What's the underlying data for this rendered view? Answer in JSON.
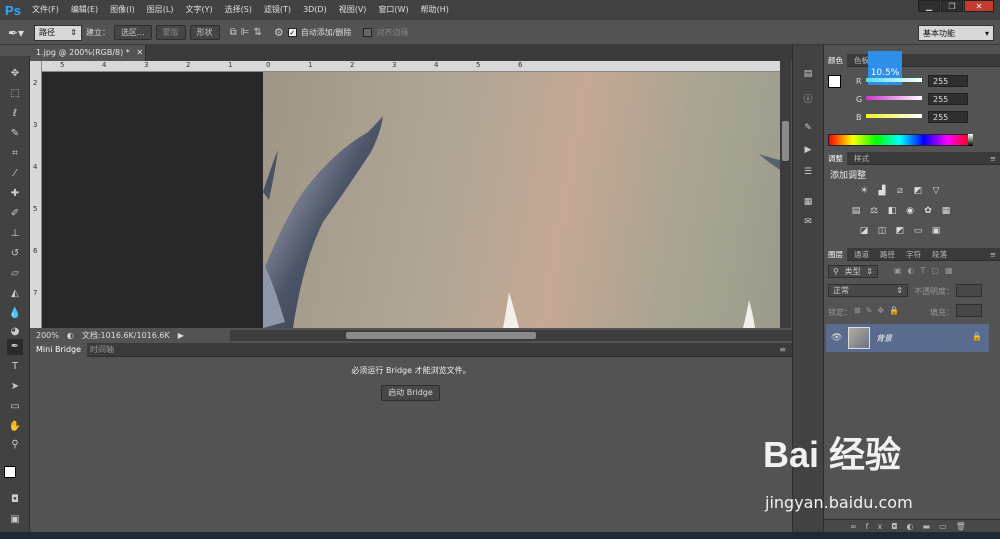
{
  "app": {
    "logo": "Ps"
  },
  "menu": [
    "文件(F)",
    "编辑(E)",
    "图像(I)",
    "图层(L)",
    "文字(Y)",
    "选择(S)",
    "滤镜(T)",
    "3D(D)",
    "视图(V)",
    "窗口(W)",
    "帮助(H)"
  ],
  "window_controls": {
    "minimize": "▁",
    "restore": "❐",
    "close": "✕"
  },
  "options": {
    "tool_mode": "路径",
    "build_label": "建立：",
    "selection_btn": "选区...",
    "mask_btn": "蒙版",
    "shape_btn": "形状",
    "auto_add_delete": "自动添加/删除",
    "align_edges": "对齐边缘",
    "workspace": "基本功能"
  },
  "document": {
    "tab_title": "1.jpg @ 200%(RGB/8) *",
    "zoom": "200%",
    "doc_info": "文档:1016.6K/1016.6K",
    "ruler_top_labels": [
      "5",
      "4",
      "3",
      "2",
      "1",
      "0",
      "1",
      "2",
      "3",
      "4",
      "5",
      "6"
    ],
    "ruler_left_labels": [
      "2",
      "3",
      "4",
      "5",
      "6",
      "7"
    ]
  },
  "bridge": {
    "tab_mini_bridge": "Mini Bridge",
    "tab_timeline": "时间轴",
    "message": "必须运行 Bridge 才能浏览文件。",
    "launch_button": "启动 Bridge"
  },
  "color_panel": {
    "tab_color": "颜色",
    "tab_swatches": "色板",
    "tooltip": "10.5%",
    "channels": [
      {
        "label": "R",
        "value": "255",
        "color": "#e8e8e8"
      },
      {
        "label": "G",
        "value": "255",
        "color": "#e040e0"
      },
      {
        "label": "B",
        "value": "255",
        "color": "#f0f040"
      }
    ]
  },
  "adjust_panel": {
    "tab_adjust": "调整",
    "tab_styles": "样式",
    "heading": "添加调整"
  },
  "layers_panel": {
    "tabs": [
      "图层",
      "通道",
      "路径",
      "字符",
      "段落"
    ],
    "filter_type": "类型",
    "blend_mode": "正常",
    "opacity_label": "不透明度：",
    "lock_label": "锁定：",
    "fill_label": "填充：",
    "layer_name": "背景"
  },
  "watermark": {
    "brand": "Bai  经验",
    "url": "jingyan.baidu.com"
  }
}
